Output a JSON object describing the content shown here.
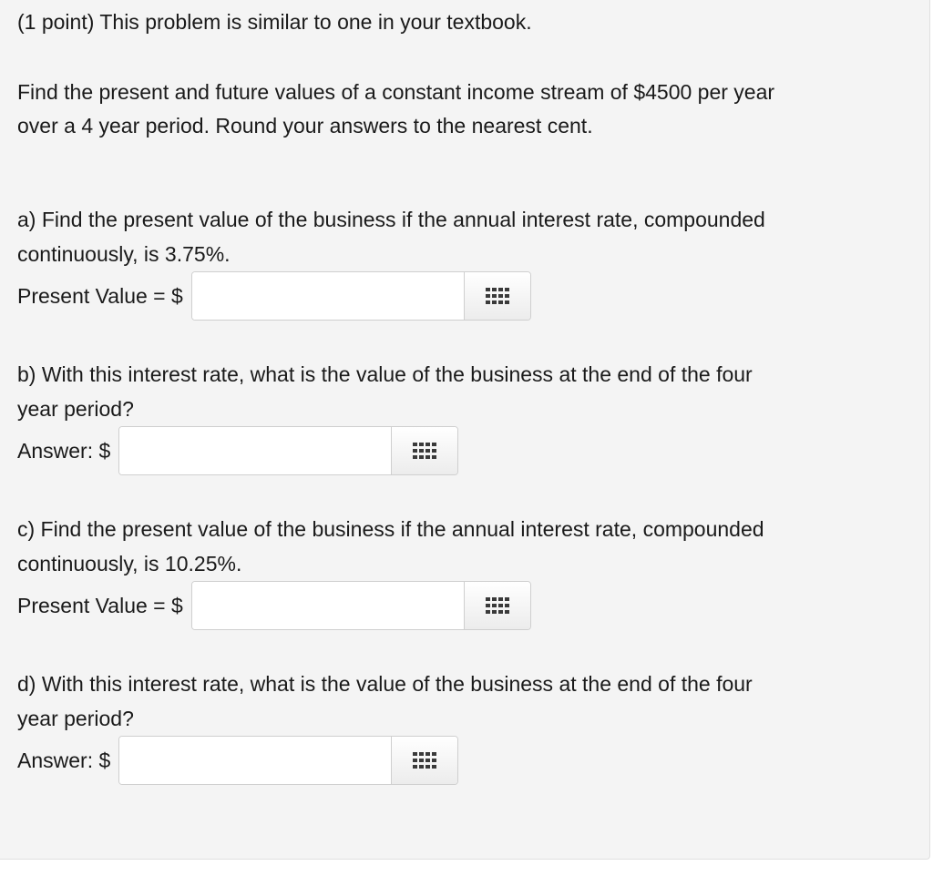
{
  "problem": {
    "header": "(1 point) This problem is similar to one in your textbook.",
    "intro_lines": [
      "Find the present and future values of a constant income stream of $4500 per year",
      "over a 4 year period. Round your answers to the nearest cent."
    ]
  },
  "parts": [
    {
      "prompt_lines": [
        "a) Find the present value of the business if the annual interest rate, compounded",
        "continuously, is 3.75%."
      ],
      "answer_label": "Present Value = $",
      "answer_value": ""
    },
    {
      "prompt_lines": [
        "b) With this interest rate, what is the value of the business at the end of the four",
        "year period?"
      ],
      "answer_label": "Answer: $",
      "answer_value": ""
    },
    {
      "prompt_lines": [
        "c) Find the present value of the business if the annual interest rate, compounded",
        "continuously, is 10.25%."
      ],
      "answer_label": "Present Value = $",
      "answer_value": ""
    },
    {
      "prompt_lines": [
        "d) With this interest rate, what is the value of the business at the end of the four",
        "year period?"
      ],
      "answer_label": "Answer: $",
      "answer_value": ""
    }
  ],
  "icons": {
    "palette": "equation-palette-icon"
  },
  "colors": {
    "panel_background": "#f4f4f4",
    "text": "#1a1a1a",
    "icon": "#3a3a3a"
  }
}
